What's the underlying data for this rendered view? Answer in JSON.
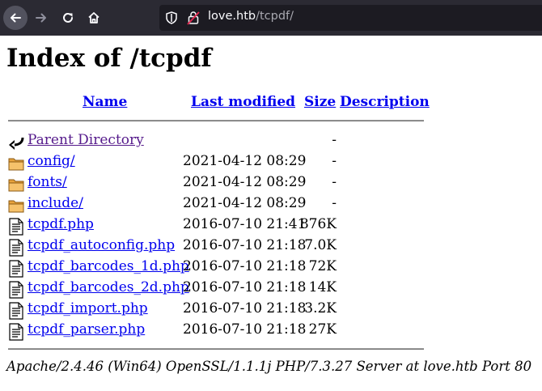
{
  "browser": {
    "url_host": "love.htb",
    "url_path": "/tcpdf/"
  },
  "page": {
    "title": "Index of /tcpdf",
    "columns": {
      "name": "Name",
      "last_modified": "Last modified",
      "size": "Size",
      "description": "Description"
    },
    "entries": [
      {
        "icon": "parent-directory-icon",
        "name": "Parent Directory",
        "date": "",
        "size": "-"
      },
      {
        "icon": "folder-icon",
        "name": "config/",
        "date": "2021-04-12 08:29",
        "size": "-"
      },
      {
        "icon": "folder-icon",
        "name": "fonts/",
        "date": "2021-04-12 08:29",
        "size": "-"
      },
      {
        "icon": "folder-icon",
        "name": "include/",
        "date": "2021-04-12 08:29",
        "size": "-"
      },
      {
        "icon": "text-file-icon",
        "name": "tcpdf.php",
        "date": "2016-07-10 21:41",
        "size": "876K"
      },
      {
        "icon": "text-file-icon",
        "name": "tcpdf_autoconfig.php",
        "date": "2016-07-10 21:18",
        "size": "7.0K"
      },
      {
        "icon": "text-file-icon",
        "name": "tcpdf_barcodes_1d.php",
        "date": "2016-07-10 21:18",
        "size": "72K"
      },
      {
        "icon": "text-file-icon",
        "name": "tcpdf_barcodes_2d.php",
        "date": "2016-07-10 21:18",
        "size": "14K"
      },
      {
        "icon": "text-file-icon",
        "name": "tcpdf_import.php",
        "date": "2016-07-10 21:18",
        "size": "3.2K"
      },
      {
        "icon": "text-file-icon",
        "name": "tcpdf_parser.php",
        "date": "2016-07-10 21:18",
        "size": "27K"
      }
    ],
    "footer": "Apache/2.4.46 (Win64) OpenSSL/1.1.1j PHP/7.3.27 Server at love.htb Port 80"
  },
  "colors": {
    "link": "#0000ee",
    "visited_link": "#551a8b",
    "toolbar": "#2b2a33",
    "urlbar": "#1c1b22"
  }
}
